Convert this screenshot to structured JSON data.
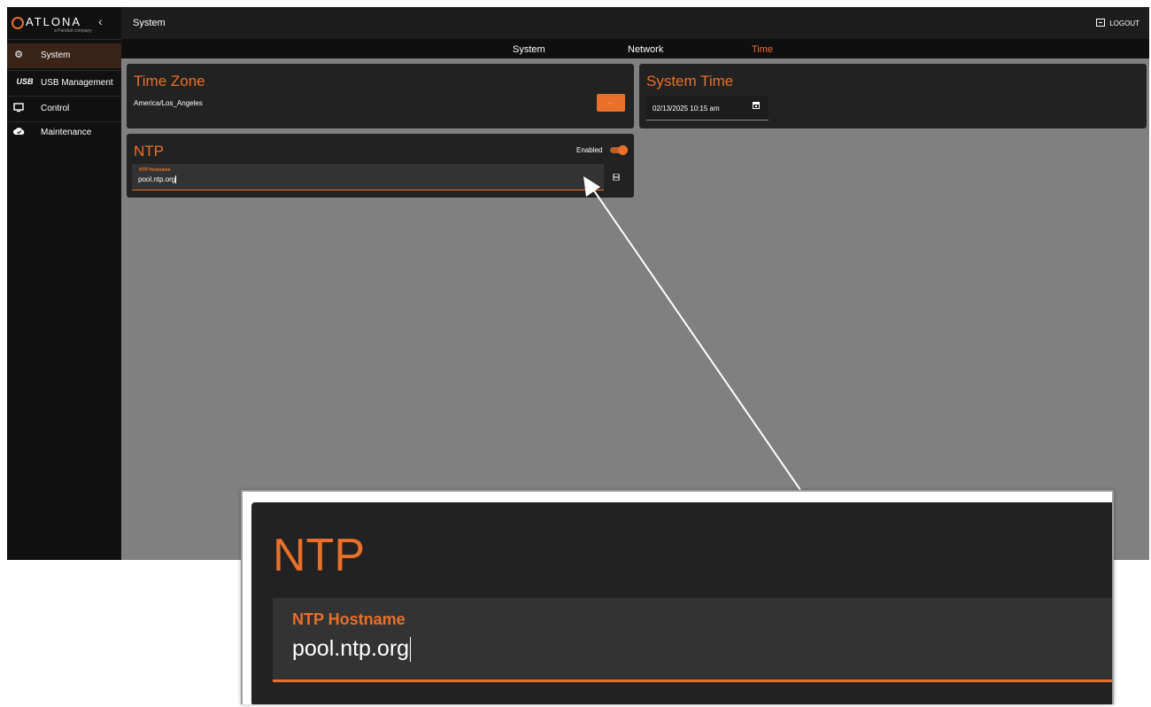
{
  "brand": {
    "name": "ATLONA",
    "tagline": "a Panduit company"
  },
  "sidebar": {
    "items": [
      {
        "label": "System",
        "icon": "gear-icon"
      },
      {
        "label": "USB Management",
        "icon": "usb-icon",
        "icon_text": "USB"
      },
      {
        "label": "Control",
        "icon": "monitor-icon"
      },
      {
        "label": "Maintenance",
        "icon": "cloud-icon"
      }
    ]
  },
  "header": {
    "title": "System",
    "logout_label": "LOGOUT"
  },
  "tabs": [
    {
      "label": "System"
    },
    {
      "label": "Network"
    },
    {
      "label": "Time",
      "active": true
    }
  ],
  "time_zone": {
    "title": "Time Zone",
    "value": "America/Los_Angeles",
    "button_label": "..."
  },
  "system_time": {
    "title": "System Time",
    "value": "02/13/2025 10:15 am"
  },
  "ntp": {
    "title": "NTP",
    "enabled_label": "Enabled",
    "enabled": true,
    "hostname_label": "NTP Hostname",
    "hostname_value": "pool.ntp.org"
  },
  "callout": {
    "title": "NTP",
    "hostname_label": "NTP Hostname",
    "hostname_value": "pool.ntp.org"
  },
  "colors": {
    "accent": "#e8702a",
    "sidebar_bg": "#111111",
    "card_bg": "#222222",
    "content_bg": "#808080"
  }
}
